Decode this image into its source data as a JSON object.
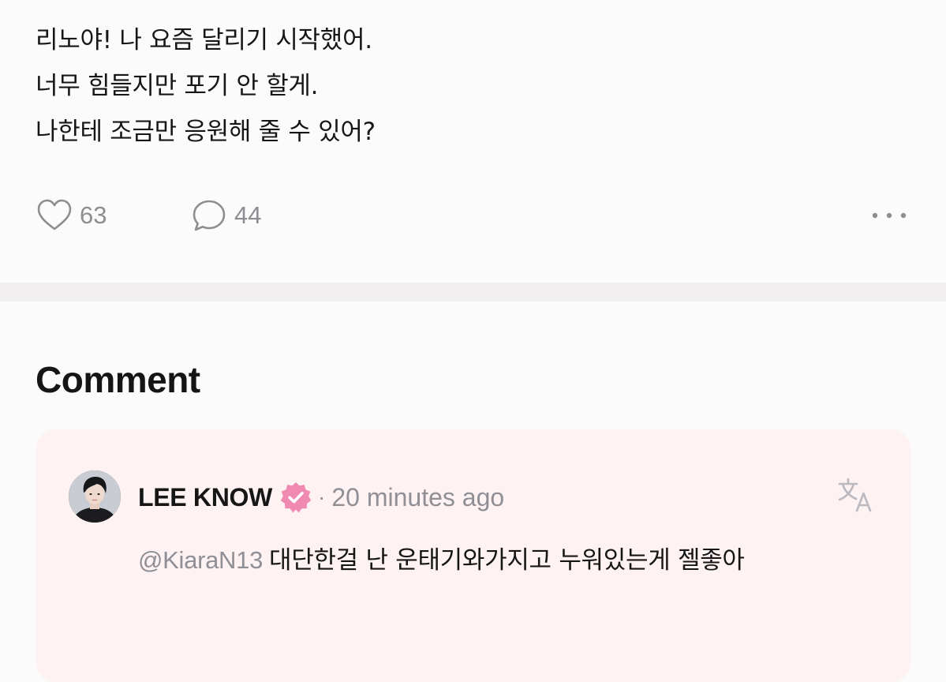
{
  "post": {
    "lines": [
      "리노야! 나 요즘 달리기 시작했어.",
      "너무 힘들지만 포기 안 할게.",
      "나한테 조금만 응원해 줄 수 있어?"
    ],
    "likes": "63",
    "comments": "44",
    "icons": {
      "like": "heart-outline-icon",
      "comment": "speech-bubble-icon",
      "more": "more-dots-icon"
    }
  },
  "comment_section": {
    "title": "Comment",
    "comment": {
      "author": "LEE KNOW",
      "separator": "·",
      "time": "20 minutes ago",
      "mention": "@KiaraN13",
      "text": "대단한걸 난 운태기와가지고 누워있는게 젤좋아",
      "icons": {
        "badge": "verified-badge-icon",
        "translate": "translate-icon"
      }
    }
  },
  "colors": {
    "background": "#fcfbfb",
    "divider": "#f1efef",
    "card": "#fef2f3",
    "accent_pink": "#f08ab1",
    "muted_text": "#8f8f95"
  }
}
